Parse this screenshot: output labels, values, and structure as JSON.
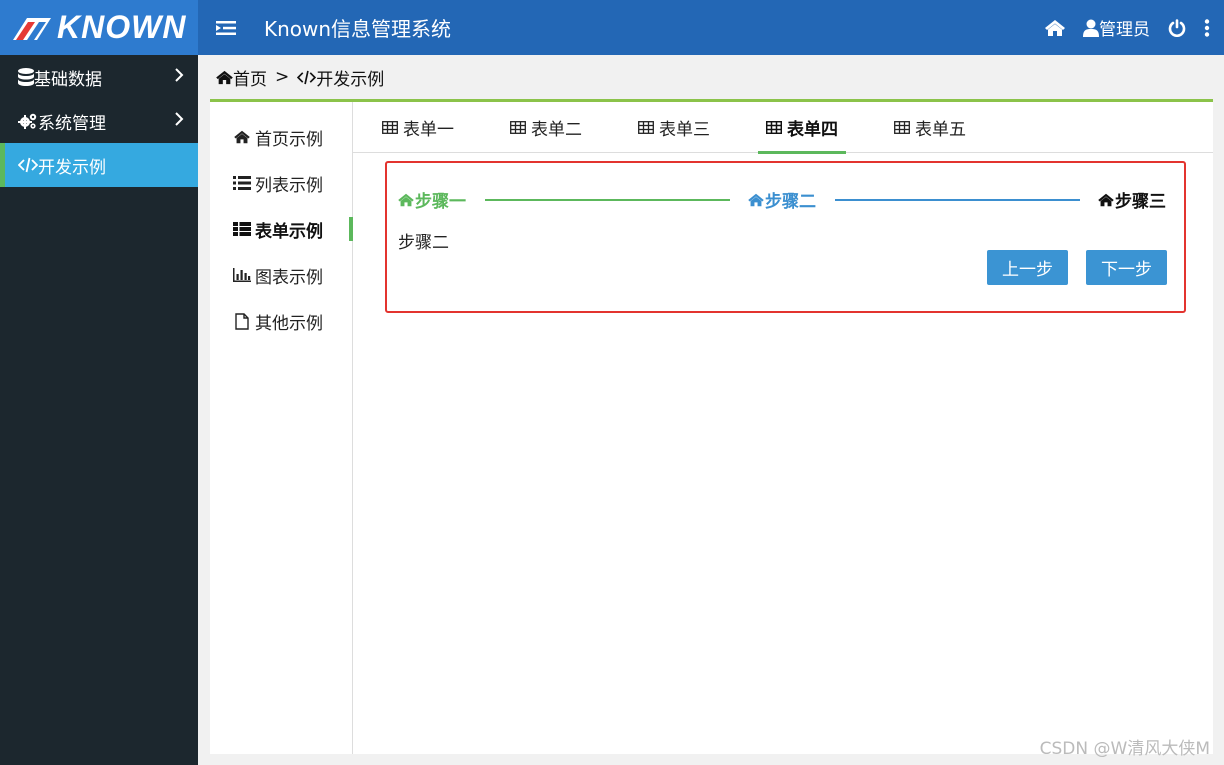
{
  "brand": {
    "logo_text": "KNOWN",
    "logo_accent": "#e53935"
  },
  "header": {
    "app_title": "Known信息管理系统",
    "user_label": "管理员"
  },
  "sidebar": {
    "items": [
      {
        "label": "基础数据",
        "icon": "database-icon"
      },
      {
        "label": "系统管理",
        "icon": "gears-icon"
      },
      {
        "label": "开发示例",
        "icon": "code-icon",
        "active": true
      }
    ]
  },
  "breadcrumb": {
    "home": "首页",
    "sep": ">",
    "current": "开发示例"
  },
  "subnav": {
    "items": [
      {
        "label": "首页示例",
        "icon": "home-icon"
      },
      {
        "label": "列表示例",
        "icon": "list-icon"
      },
      {
        "label": "表单示例",
        "icon": "th-list-icon",
        "active": true
      },
      {
        "label": "图表示例",
        "icon": "bar-chart-icon"
      },
      {
        "label": "其他示例",
        "icon": "file-icon"
      }
    ]
  },
  "tabs": [
    {
      "label": "表单一"
    },
    {
      "label": "表单二"
    },
    {
      "label": "表单三"
    },
    {
      "label": "表单四",
      "active": true
    },
    {
      "label": "表单五"
    }
  ],
  "stepper": {
    "steps": [
      {
        "label": "步骤一",
        "state": "done",
        "color": "#5cb85c"
      },
      {
        "label": "步骤二",
        "state": "current",
        "color": "#3b8fd0"
      },
      {
        "label": "步骤三",
        "state": "todo",
        "color": "#111111"
      }
    ],
    "body_text": "步骤二",
    "prev_label": "上一步",
    "next_label": "下一步"
  },
  "watermark": "CSDN @W清风大侠M",
  "colors": {
    "topbar": "#2367b5",
    "sidebar": "#1c272e",
    "active": "#35a9e0",
    "accent_green": "#5cb85c",
    "button": "#3b94d3",
    "highlight_border": "#e3342f"
  }
}
